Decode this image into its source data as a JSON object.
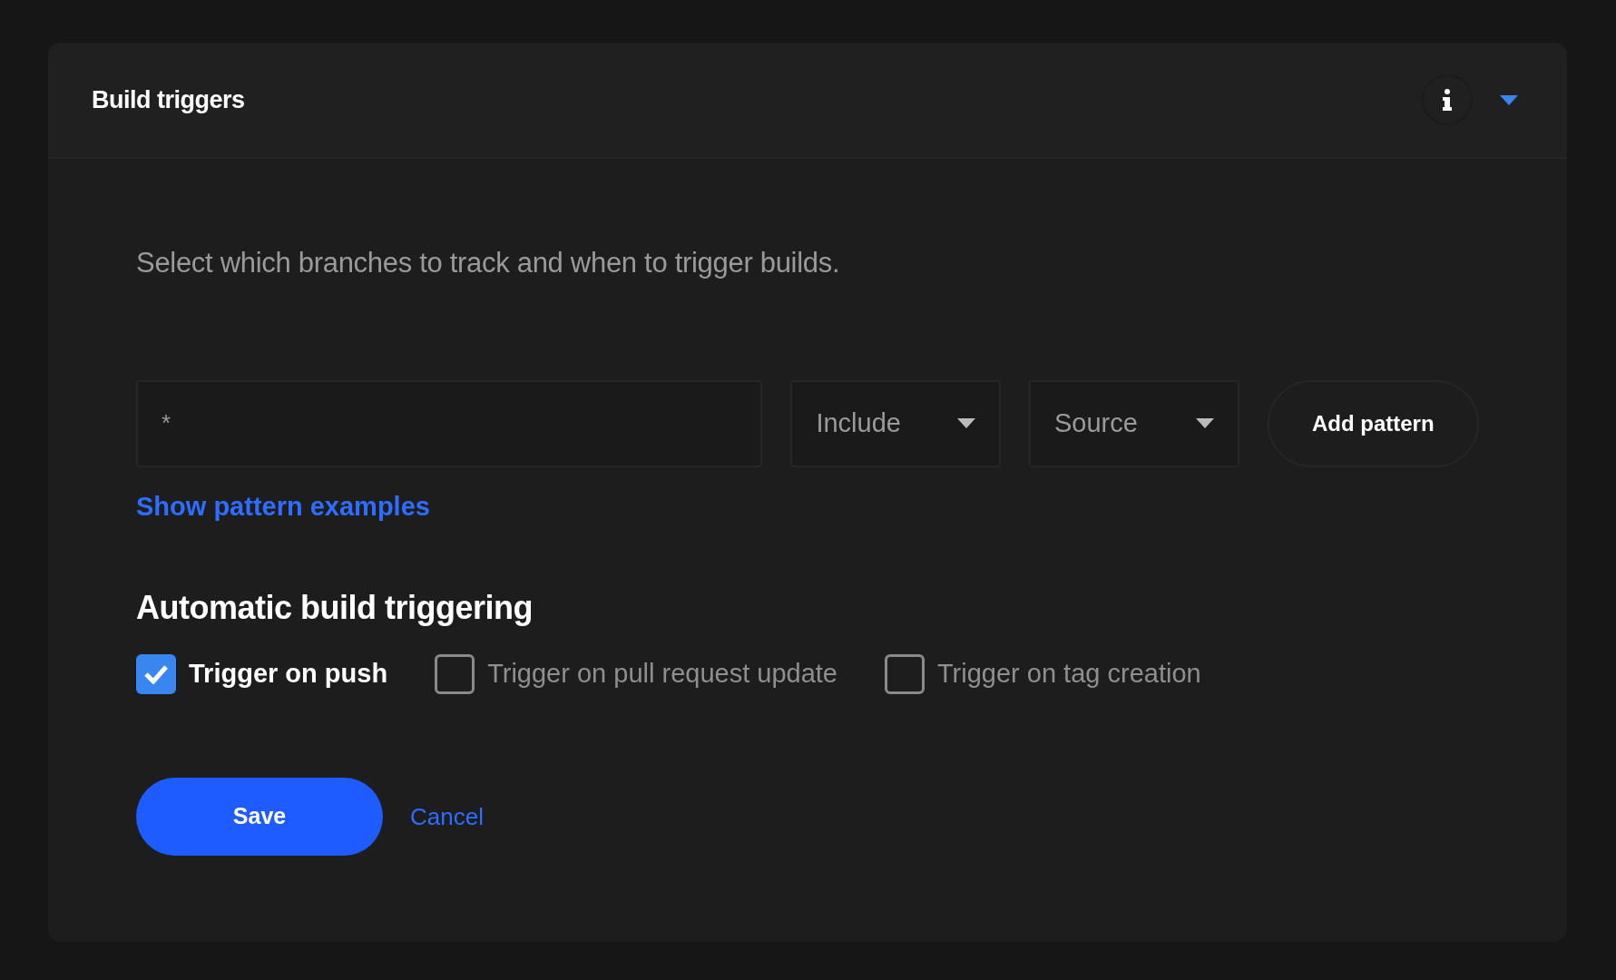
{
  "panel": {
    "title": "Build triggers",
    "expanded": true
  },
  "description": "Select which branches to track and when to trigger builds.",
  "pattern": {
    "placeholder": "*",
    "mode": "Include",
    "target": "Source",
    "add_button": "Add pattern"
  },
  "examples_link": "Show pattern examples",
  "section_title": "Automatic build triggering",
  "options": [
    {
      "label": "Trigger on push",
      "checked": true
    },
    {
      "label": "Trigger on pull request update",
      "checked": false
    },
    {
      "label": "Trigger on tag creation",
      "checked": false
    }
  ],
  "actions": {
    "save": "Save",
    "cancel": "Cancel"
  }
}
